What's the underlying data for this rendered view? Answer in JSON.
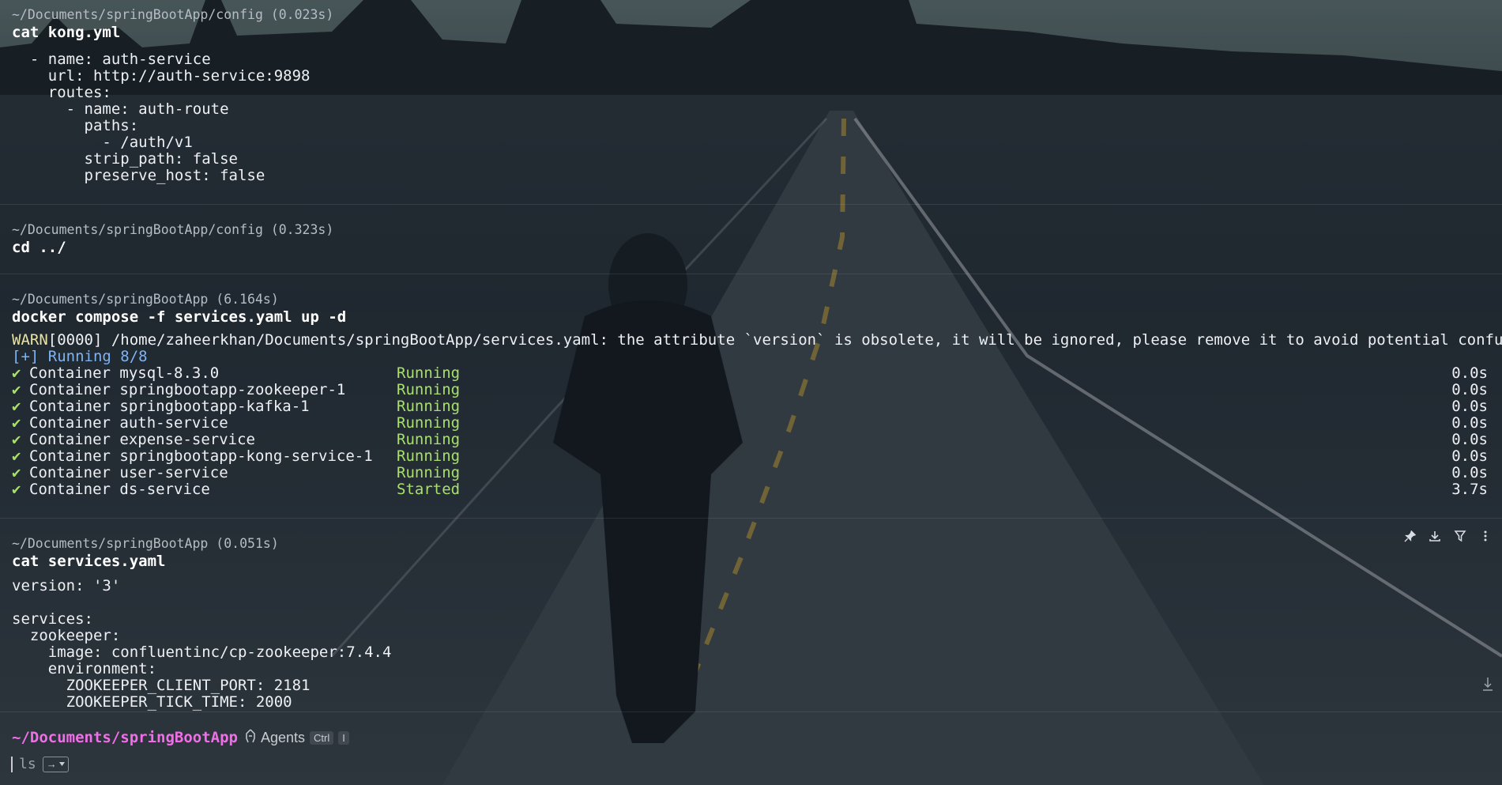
{
  "blocks": [
    {
      "path": "~/Documents/springBootApp/config (0.023s)",
      "command": "cat kong.yml",
      "output": "  - name: auth-service\n    url: http://auth-service:9898\n    routes:\n      - name: auth-route\n        paths:\n          - /auth/v1\n        strip_path: false\n        preserve_host: false"
    },
    {
      "path": "~/Documents/springBootApp/config (0.323s)",
      "command": "cd ../"
    },
    {
      "path": "~/Documents/springBootApp (6.164s)",
      "command": "docker compose -f services.yaml up -d",
      "warn_prefix": "WARN",
      "warn_rest": "[0000] /home/zaheerkhan/Documents/springBootApp/services.yaml: the attribute `version` is obsolete, it will be ignored, please remove it to avoid potential confusion",
      "summary": "[+] Running 8/8",
      "containers": [
        {
          "name": "Container mysql-8.3.0",
          "status": "Running",
          "time": "0.0s"
        },
        {
          "name": "Container springbootapp-zookeeper-1",
          "status": "Running",
          "time": "0.0s"
        },
        {
          "name": "Container springbootapp-kafka-1",
          "status": "Running",
          "time": "0.0s"
        },
        {
          "name": "Container auth-service",
          "status": "Running",
          "time": "0.0s"
        },
        {
          "name": "Container expense-service",
          "status": "Running",
          "time": "0.0s"
        },
        {
          "name": "Container springbootapp-kong-service-1",
          "status": "Running",
          "time": "0.0s"
        },
        {
          "name": "Container user-service",
          "status": "Running",
          "time": "0.0s"
        },
        {
          "name": "Container ds-service",
          "status": "Started",
          "time": "3.7s"
        }
      ],
      "check_glyph": "✔"
    },
    {
      "path": "~/Documents/springBootApp (0.051s)",
      "command": "cat services.yaml",
      "output": "version: '3'\n\nservices:\n  zookeeper:\n    image: confluentinc/cp-zookeeper:7.4.4\n    environment:\n      ZOOKEEPER_CLIENT_PORT: 2181\n      ZOOKEEPER_TICK_TIME: 2000"
    }
  ],
  "block_toolbar_icons": [
    "pin-icon",
    "download-icon",
    "filter-icon",
    "more-vertical-icon"
  ],
  "prompt": {
    "path": "~/Documents/springBootApp",
    "agents_label": "Agents",
    "shortcut_key": "Ctrl",
    "shortcut_char": "I",
    "input_value": "ls",
    "accept_glyph": "→"
  },
  "colors": {
    "prompt_path": "#f06fe8",
    "running": "#a8e06b",
    "summary": "#7fb3f2",
    "warn": "#e8e3a0"
  }
}
